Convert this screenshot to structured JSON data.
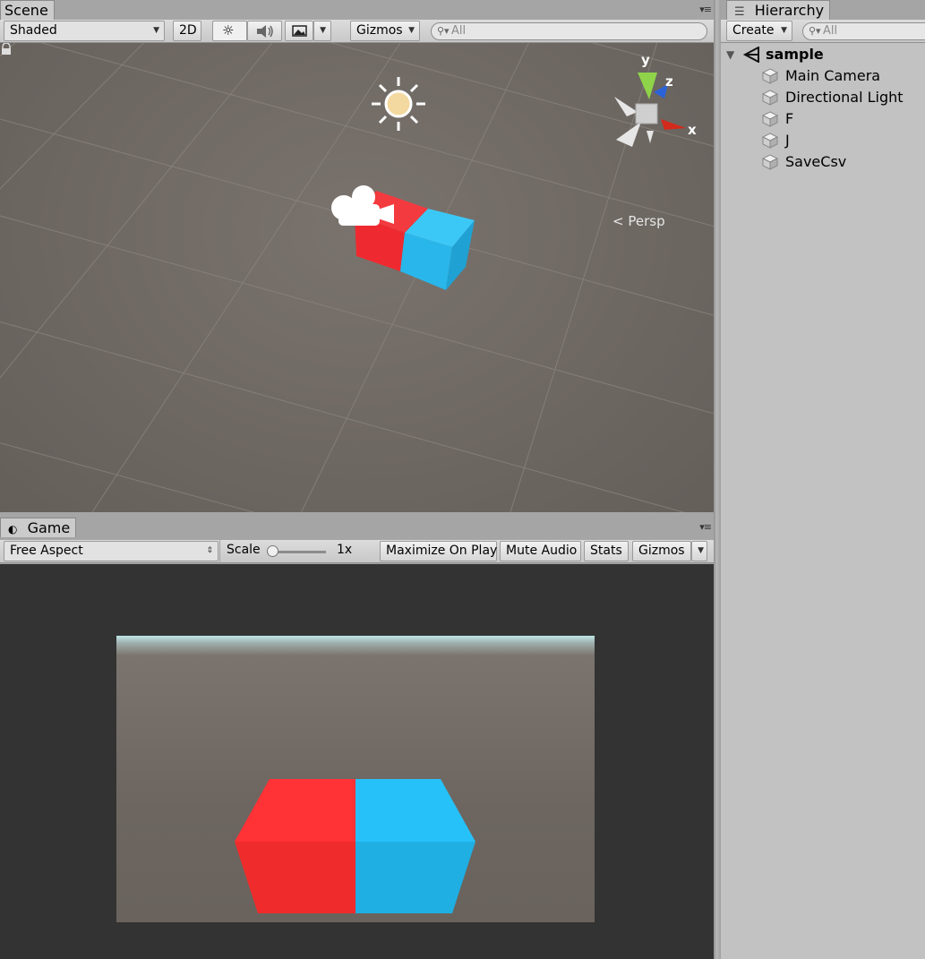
{
  "scene": {
    "tab_label": "Scene",
    "shading_mode": "Shaded",
    "btn_2d": "2D",
    "gizmos_label": "Gizmos",
    "search_placeholder": "All",
    "projection_label": "Persp",
    "axis_labels": {
      "x": "x",
      "y": "y",
      "z": "z"
    },
    "icons": {
      "lighting": "sun-icon",
      "audio": "speaker-icon",
      "effects": "image-icon",
      "lock": "lock-icon"
    }
  },
  "game": {
    "tab_label": "Game",
    "aspect": "Free Aspect",
    "scale_label": "Scale",
    "scale_value": "1x",
    "maximize_on_play": "Maximize On Play",
    "mute_audio": "Mute Audio",
    "stats": "Stats",
    "gizmos_label": "Gizmos"
  },
  "hierarchy": {
    "tab_label": "Hierarchy",
    "create_label": "Create",
    "search_placeholder": "All",
    "scene_name": "sample",
    "items": [
      {
        "label": "Main Camera"
      },
      {
        "label": "Directional Light"
      },
      {
        "label": "F"
      },
      {
        "label": "J"
      },
      {
        "label": "SaveCsv"
      }
    ]
  },
  "colors": {
    "cube_red": "#ff2d35",
    "cube_blue": "#22bdf7",
    "scene_background": "#6b6560",
    "game_background": "#333333",
    "panel_gray": "#c2c2c2"
  }
}
